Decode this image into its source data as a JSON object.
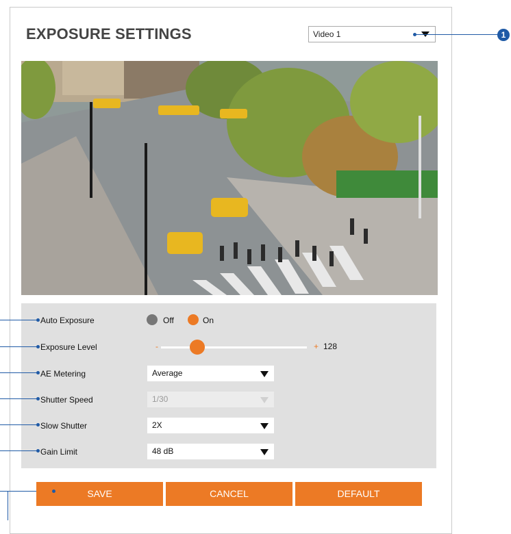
{
  "header": {
    "title": "EXPOSURE SETTINGS"
  },
  "video_select": {
    "value": "Video 1"
  },
  "callout": {
    "number": "1"
  },
  "settings": {
    "auto_exposure": {
      "label": "Auto Exposure",
      "off_label": "Off",
      "on_label": "On",
      "selected": "On"
    },
    "exposure_level": {
      "label": "Exposure Level",
      "minus": "-",
      "plus": "+",
      "value": "128",
      "fraction": 0.25
    },
    "ae_metering": {
      "label": "AE Metering",
      "value": "Average"
    },
    "shutter_speed": {
      "label": "Shutter Speed",
      "value": "1/30"
    },
    "slow_shutter": {
      "label": "Slow Shutter",
      "value": "2X"
    },
    "gain_limit": {
      "label": "Gain Limit",
      "value": "48 dB"
    }
  },
  "buttons": {
    "save": "SAVE",
    "cancel": "CANCEL",
    "default": "DEFAULT"
  },
  "colors": {
    "accent": "#ec7a25",
    "callout": "#1f5aa6"
  }
}
